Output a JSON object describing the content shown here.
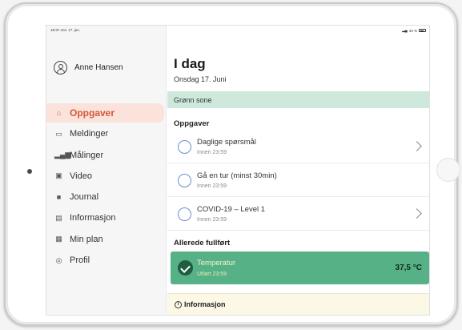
{
  "status_bar": {
    "time": "18:37 ons. 17. jun.",
    "right": "43 %"
  },
  "user": {
    "name": "Anne Hansen"
  },
  "nav": {
    "items": [
      {
        "label": "Oppgaver",
        "icon": "home-icon",
        "active": true
      },
      {
        "label": "Meldinger",
        "icon": "messages-icon",
        "active": false
      },
      {
        "label": "Målinger",
        "icon": "bar-chart-icon",
        "active": false
      },
      {
        "label": "Video",
        "icon": "video-icon",
        "active": false
      },
      {
        "label": "Journal",
        "icon": "journal-icon",
        "active": false
      },
      {
        "label": "Informasjon",
        "icon": "document-icon",
        "active": false
      },
      {
        "label": "Min plan",
        "icon": "calendar-icon",
        "active": false
      },
      {
        "label": "Profil",
        "icon": "profile-icon",
        "active": false
      }
    ]
  },
  "main": {
    "title": "I dag",
    "date": "Onsdag 17. Juni",
    "zone": "Grønn sone",
    "tasks_heading": "Oppgaver",
    "tasks": [
      {
        "title": "Daglige spørsmål",
        "due": "Innen 23:59"
      },
      {
        "title": "Gå en tur (minst 30min)",
        "due": "Innen 23:59"
      },
      {
        "title": "COVID-19 – Level 1",
        "due": "Innen 23:59"
      }
    ],
    "done_heading": "Allerede fullført",
    "done": [
      {
        "title": "Temperatur",
        "due": "Utført 23:59",
        "value": "37,5 °C"
      }
    ],
    "info_heading": "Informasjon"
  },
  "colors": {
    "accent": "#d4583b",
    "active_bg": "#fbe3dc",
    "zone_green": "#cfe8dc",
    "done_green": "#56b187",
    "circle_blue": "#6a8fcf"
  }
}
